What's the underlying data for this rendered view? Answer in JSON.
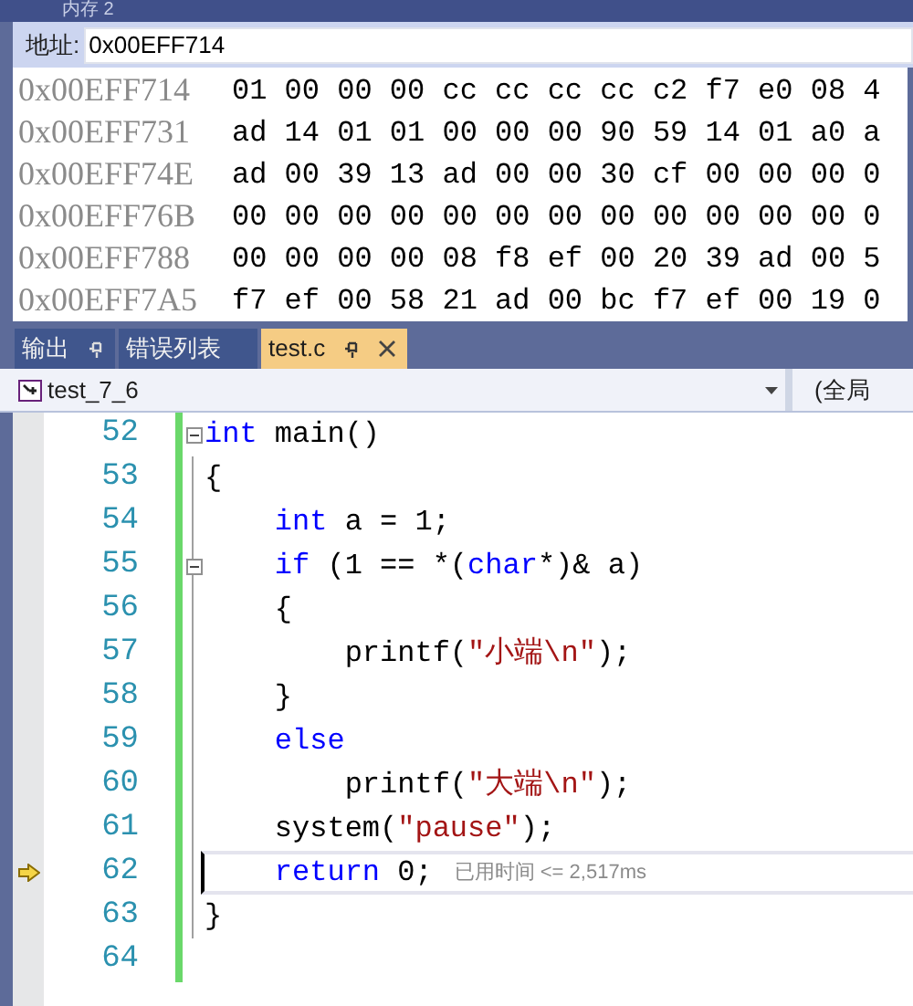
{
  "memory_window": {
    "title": "内存 2",
    "address_label": "地址:",
    "address": "0x00EFF714",
    "rows": [
      {
        "address": "0x00EFF714",
        "bytes": "01 00 00 00 cc cc cc cc c2 f7 e0 08 4"
      },
      {
        "address": "0x00EFF731",
        "bytes": "ad 14 01 01 00 00 00 90 59 14 01 a0 a"
      },
      {
        "address": "0x00EFF74E",
        "bytes": "ad 00 39 13 ad 00 00 30 cf 00 00 00 0"
      },
      {
        "address": "0x00EFF76B",
        "bytes": "00 00 00 00 00 00 00 00 00 00 00 00 0"
      },
      {
        "address": "0x00EFF788",
        "bytes": "00 00 00 00 08 f8 ef 00 20 39 ad 00 5"
      },
      {
        "address": "0x00EFF7A5",
        "bytes": "f7 ef 00 58 21 ad 00 bc f7 ef 00 19 0"
      }
    ]
  },
  "tabs": [
    {
      "label": "输出",
      "selected": false,
      "pinned": true,
      "closable": false
    },
    {
      "label": "错误列表",
      "selected": false,
      "pinned": false,
      "closable": false
    },
    {
      "label": "test.c",
      "selected": true,
      "pinned": true,
      "closable": true
    }
  ],
  "navigation": {
    "scope": "test_7_6",
    "global_scope": "(全局"
  },
  "editor": {
    "lines": [
      {
        "number": "52",
        "fold": true,
        "current": false,
        "tokens": [
          {
            "kind": "kw",
            "t": "int"
          },
          {
            "kind": "text",
            "t": " main()"
          }
        ]
      },
      {
        "number": "53",
        "fold": false,
        "current": false,
        "tokens": [
          {
            "kind": "text",
            "t": "{"
          }
        ]
      },
      {
        "number": "54",
        "fold": false,
        "current": false,
        "tokens": [
          {
            "kind": "kw",
            "t": "    int"
          },
          {
            "kind": "text",
            "t": " a = 1;"
          }
        ]
      },
      {
        "number": "55",
        "fold": true,
        "current": false,
        "tokens": [
          {
            "kind": "kw",
            "t": "    if"
          },
          {
            "kind": "text",
            "t": " (1 == *("
          },
          {
            "kind": "kw",
            "t": "char"
          },
          {
            "kind": "text",
            "t": "*)& a)"
          }
        ]
      },
      {
        "number": "56",
        "fold": false,
        "current": false,
        "tokens": [
          {
            "kind": "text",
            "t": "    {"
          }
        ]
      },
      {
        "number": "57",
        "fold": false,
        "current": false,
        "tokens": [
          {
            "kind": "text",
            "t": "        printf("
          },
          {
            "kind": "str",
            "t": "\"小端\\n\""
          },
          {
            "kind": "text",
            "t": ");"
          }
        ]
      },
      {
        "number": "58",
        "fold": false,
        "current": false,
        "tokens": [
          {
            "kind": "text",
            "t": "    }"
          }
        ]
      },
      {
        "number": "59",
        "fold": false,
        "current": false,
        "tokens": [
          {
            "kind": "kw",
            "t": "    else"
          }
        ]
      },
      {
        "number": "60",
        "fold": false,
        "current": false,
        "tokens": [
          {
            "kind": "text",
            "t": "        printf("
          },
          {
            "kind": "str",
            "t": "\"大端\\n\""
          },
          {
            "kind": "text",
            "t": ");"
          }
        ]
      },
      {
        "number": "61",
        "fold": false,
        "current": false,
        "tokens": [
          {
            "kind": "text",
            "t": "    system("
          },
          {
            "kind": "str",
            "t": "\"pause\""
          },
          {
            "kind": "text",
            "t": ");"
          }
        ]
      },
      {
        "number": "62",
        "fold": false,
        "current": true,
        "elapsed": "已用时间 <= 2,517ms",
        "tokens": [
          {
            "kind": "kw",
            "t": "    return"
          },
          {
            "kind": "text",
            "t": " 0;"
          }
        ]
      },
      {
        "number": "63",
        "fold": false,
        "current": false,
        "tokens": [
          {
            "kind": "text",
            "t": "}"
          }
        ]
      },
      {
        "number": "64",
        "fold": false,
        "current": false
      }
    ]
  }
}
